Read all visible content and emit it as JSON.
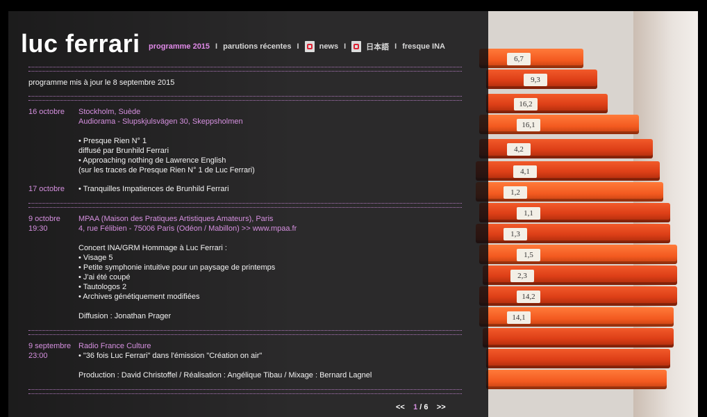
{
  "site": {
    "logo": "luc ferrari"
  },
  "nav": {
    "programme": "programme  2015",
    "parutions": "parutions  récentes",
    "news": "news",
    "japanese": "日本語",
    "fresque": "fresque INA",
    "separator": "I"
  },
  "content": {
    "updated": "programme mis à jour le 8 septembre 2015",
    "events": [
      {
        "date": "16 octobre",
        "venue": "Stockholm, Suède",
        "address": "Audiorama - Slupskjulsvägen 30, Skeppsholmen",
        "lines": [
          "• Presque Rien N° 1",
          "diffusé par Brunhild Ferrari",
          "• Approaching nothing de Lawrence English",
          "(sur les traces de Presque Rien N° 1 de Luc Ferrari)"
        ]
      },
      {
        "date": "17 octobre",
        "line": "• Tranquilles Impatiences de Brunhild Ferrari"
      },
      {
        "date": "9 octobre",
        "time": "19:30",
        "venue": "MPAA (Maison des Pratiques Artistiques Amateurs), Paris",
        "address": "4, rue Félibien - 75006 Paris (Odéon / Mabillon) >> www.mpaa.fr",
        "lines": [
          "Concert INA/GRM Hommage à Luc Ferrari :",
          "• Visage 5",
          "• Petite symphonie intuitive pour un paysage de printemps",
          "• J'ai été coupé",
          "• Tautologos 2",
          "• Archives génétiquement modifiées"
        ],
        "diffusion": "Diffusion : Jonathan Prager"
      },
      {
        "date": "9 septembre",
        "time": "23:00",
        "venue": "Radio France Culture",
        "line": "• \"36 fois Luc Ferrari\" dans l'émission \"Création on air\"",
        "production": "Production : David Christoffel / Réalisation : Angélique Tibau / Mixage : Bernard Lagnel"
      }
    ]
  },
  "pager": {
    "prev": "<<",
    "current": "1",
    "slash": "/",
    "total": "6",
    "next": ">>"
  },
  "photo_labels": [
    "6,7",
    "9,3",
    "16,2",
    "16,1",
    "4,2",
    "4,1",
    "1,2",
    "1,1",
    "1,3",
    "1,5",
    "2,3",
    "14,2",
    "14,1"
  ],
  "colors": {
    "accent_pink": "#d690e0",
    "background": "#000000",
    "box_orange": "#e8461a"
  }
}
